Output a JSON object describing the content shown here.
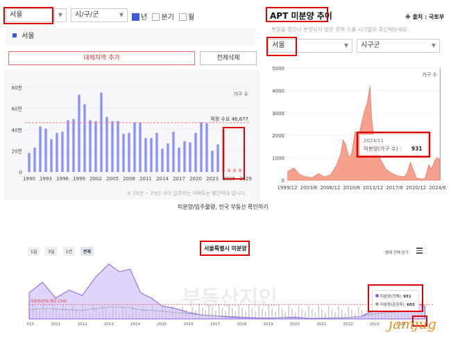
{
  "left": {
    "region_select": "서울",
    "district_select": "시/구/군",
    "period_options": [
      {
        "label": "년",
        "checked": true
      },
      {
        "label": "분기",
        "checked": false
      },
      {
        "label": "월",
        "checked": false
      }
    ],
    "selected_region_tag": "서울",
    "add_region_button": "대체지역 추가",
    "clear_all_button": "전체삭제",
    "footnote": "※ 25년 ~ 29년 사이 입주하는 아파트는 빨간막대 입니다.",
    "caption": "미분양/입주물량, 전국 부동산 확인하기"
  },
  "right": {
    "title": "APT 미분양 추이",
    "source": "※ 출처 : 국토부",
    "subtitle": "분양을 했으나 분양되지 않은 주택 수를 시기별로 확인해보세요.",
    "region_select": "서울",
    "district_select": "시구군"
  },
  "bottom": {
    "range_buttons": [
      "1일",
      "3일",
      "1년",
      "전체"
    ],
    "active_range": "전체",
    "title": "서울특별시 미분양",
    "collapse_label": "범례 전체 닫기",
    "watermark": "부동산지인",
    "avg_line_label": "미분양(전체) 평균 1100",
    "legend": [
      {
        "label": "미분양(전체):",
        "value": "931",
        "color": "#8b5cf6"
      },
      {
        "label": "미분양(준공후):",
        "value": "603",
        "color": "#9ca3af"
      }
    ],
    "brand": "jamjug"
  },
  "chart_data": [
    {
      "type": "bar",
      "title": "",
      "ylabel": "가구 수",
      "y_tick_labels": [
        "0",
        "20천",
        "40천",
        "60천",
        "80천"
      ],
      "ylim": [
        0,
        80000
      ],
      "x_tick_labels": [
        "1990",
        "1993",
        "1996",
        "1999",
        "2002",
        "2005",
        "2008",
        "2011",
        "2014",
        "2017",
        "2020",
        "2023",
        "2026",
        "2029"
      ],
      "categories": [
        1990,
        1991,
        1992,
        1993,
        1994,
        1995,
        1996,
        1997,
        1998,
        1999,
        2000,
        2001,
        2002,
        2003,
        2004,
        2005,
        2006,
        2007,
        2008,
        2009,
        2010,
        2011,
        2012,
        2013,
        2014,
        2015,
        2016,
        2017,
        2018,
        2019,
        2020,
        2021,
        2022,
        2023,
        2024,
        2025,
        2026,
        2027,
        2028
      ],
      "values": [
        18000,
        23000,
        43000,
        41000,
        31000,
        37000,
        38000,
        49000,
        50000,
        73000,
        64000,
        49000,
        48000,
        75000,
        52000,
        48000,
        48000,
        36000,
        37000,
        47000,
        47000,
        32000,
        32000,
        37000,
        22000,
        27000,
        38000,
        23000,
        29000,
        28000,
        37000,
        47000,
        46000,
        20000,
        26000,
        40000,
        3000,
        3000,
        3000
      ],
      "future_from": 2025,
      "colors": {
        "past": "#8b93f0",
        "future": "#f39a9a"
      },
      "reference_line": {
        "label": "적정 수요",
        "value_label": "46,677",
        "value": 46677,
        "color": "#f08080"
      }
    },
    {
      "type": "area",
      "title": "",
      "ylabel": "가구 수",
      "y_tick_labels": [
        "0",
        "1000",
        "2000",
        "3000",
        "4000",
        "5000"
      ],
      "ylim": [
        0,
        5000
      ],
      "x_tick_labels": [
        "1999/12",
        "2003/6",
        "2006/12",
        "2010/6",
        "2013/12",
        "2017/6",
        "2020/12",
        "2024/6"
      ],
      "x": [
        "2000/01",
        "2001/01",
        "2002/01",
        "2003/01",
        "2004/01",
        "2005/01",
        "2006/01",
        "2007/01",
        "2008/01",
        "2008/09",
        "2009/01",
        "2009/06",
        "2010/01",
        "2010/06",
        "2011/01",
        "2011/06",
        "2012/01",
        "2012/06",
        "2013/01",
        "2013/03",
        "2013/06",
        "2013/09",
        "2014/01",
        "2014/06",
        "2015/01",
        "2016/01",
        "2017/01",
        "2018/01",
        "2019/01",
        "2019/06",
        "2020/01",
        "2021/01",
        "2022/01",
        "2022/06",
        "2023/01",
        "2023/06",
        "2024/01",
        "2024/06",
        "2024/11"
      ],
      "values": [
        400,
        550,
        250,
        150,
        120,
        300,
        150,
        250,
        700,
        1200,
        1800,
        1600,
        1000,
        1200,
        2200,
        1800,
        2500,
        3000,
        3500,
        3800,
        4200,
        2800,
        2000,
        1800,
        1000,
        500,
        300,
        200,
        150,
        300,
        800,
        100,
        50,
        100,
        700,
        500,
        900,
        1000,
        931
      ],
      "color": "#f4917a",
      "tooltip": {
        "date": "2024/11",
        "label": "미분양(가구 수) :",
        "value": "931"
      }
    },
    {
      "type": "area",
      "title": "서울특별시 미분양",
      "x_tick_labels": [
        "2010",
        "2011",
        "2012",
        "2013",
        "2014",
        "2015",
        "2016",
        "2017",
        "2018",
        "2019",
        "2020",
        "2021",
        "2022",
        "2023",
        "2024"
      ],
      "x": [
        2010.0,
        2010.5,
        2011.0,
        2011.5,
        2012.0,
        2012.5,
        2013.0,
        2013.4,
        2013.8,
        2014.2,
        2014.6,
        2015.0,
        2015.5,
        2016.0,
        2016.5,
        2017.0,
        2017.5,
        2018.0,
        2018.5,
        2019.0,
        2019.5,
        2020.0,
        2020.5,
        2021.0,
        2021.5,
        2022.0,
        2022.5,
        2023.0,
        2023.5,
        2024.0,
        2024.5,
        2024.9
      ],
      "series": [
        {
          "name": "미분양(전체)",
          "color": "#8b5cf6",
          "values": [
            2000,
            2800,
            1600,
            2200,
            1800,
            3200,
            4200,
            3600,
            3800,
            2000,
            1600,
            1000,
            800,
            500,
            300,
            250,
            150,
            100,
            80,
            60,
            100,
            150,
            50,
            60,
            80,
            100,
            200,
            700,
            900,
            1000,
            1300,
            931
          ]
        },
        {
          "name": "미분양(준공후)",
          "color": "#9ca3af",
          "values": [
            700,
            800,
            750,
            700,
            650,
            800,
            900,
            900,
            850,
            700,
            650,
            600,
            500,
            400,
            300,
            250,
            200,
            150,
            100,
            80,
            90,
            100,
            60,
            60,
            70,
            90,
            200,
            400,
            500,
            550,
            600,
            603
          ]
        }
      ],
      "reference_line": {
        "label": "미분양(전체) 평균 1100",
        "value": 1100
      },
      "ylim": [
        0,
        4500
      ]
    }
  ]
}
